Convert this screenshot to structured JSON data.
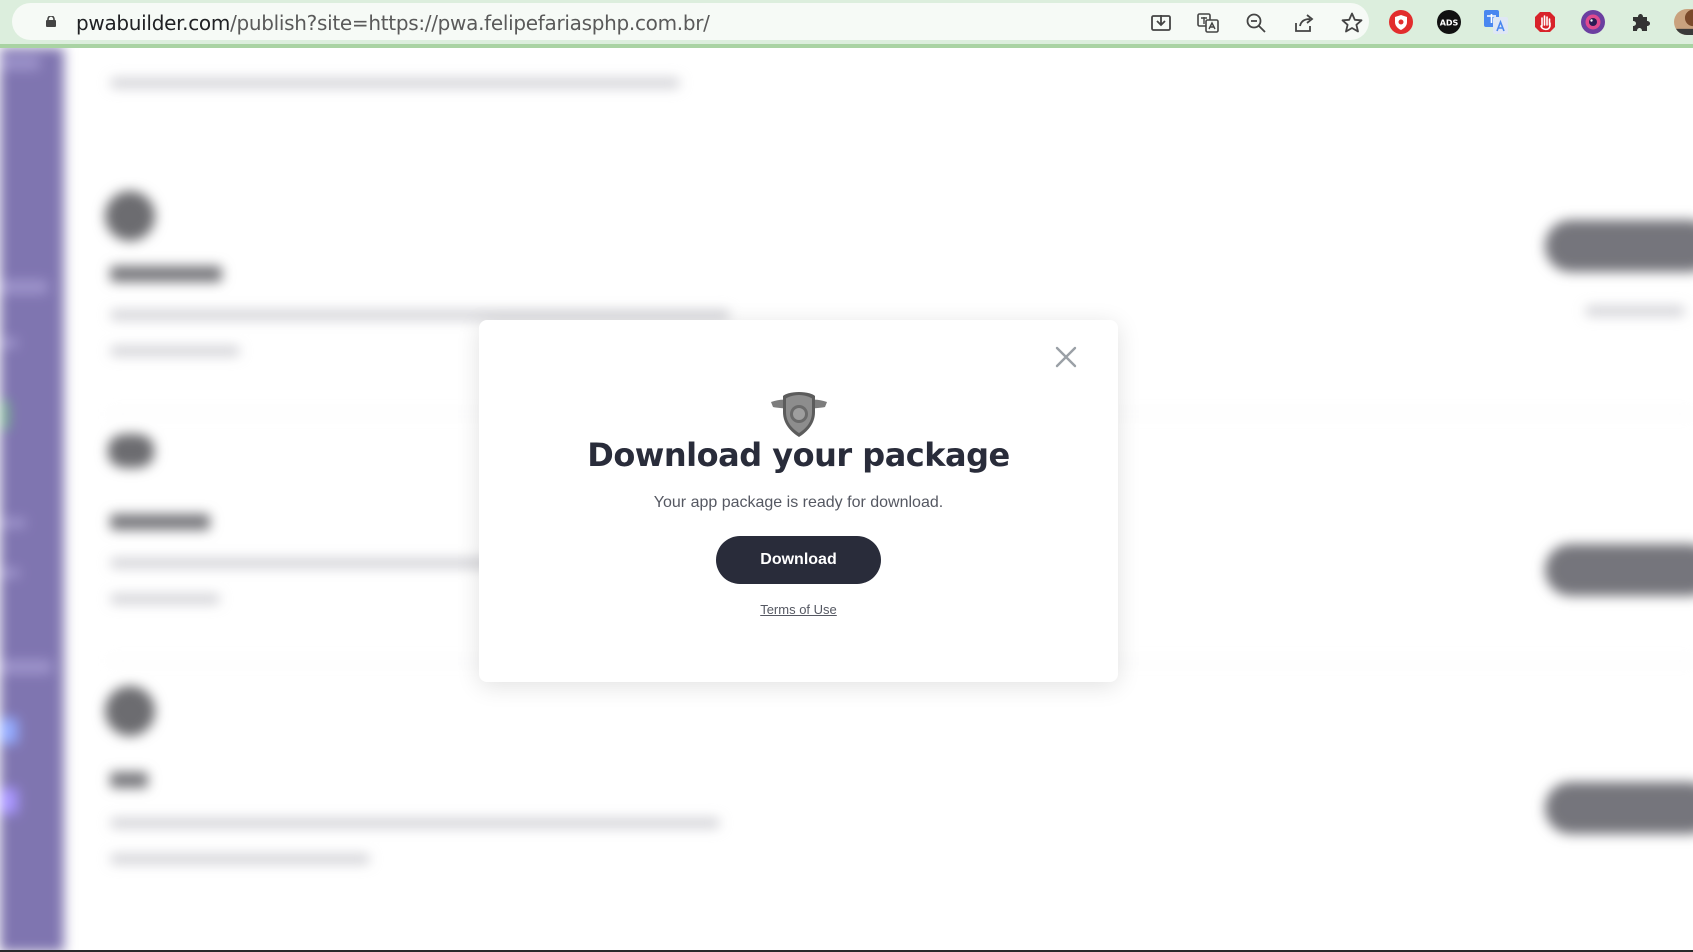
{
  "browser": {
    "url_host": "pwabuilder.com",
    "url_path": "/publish?site=https://pwa.felipefariasphp.com.br/",
    "toolbar_icons": [
      "install-app-icon",
      "translate-icon",
      "zoom-out-icon",
      "share-icon",
      "bookmark-star-icon"
    ],
    "extension_icons": [
      "shield-extension-icon",
      "ads-extension-icon",
      "google-translate-extension-icon",
      "hand-block-extension-icon",
      "camera-extension-icon",
      "puzzle-extensions-icon",
      "profile-avatar"
    ],
    "ads_badge_text": "ADS"
  },
  "modal": {
    "icon": "shield-wings-icon",
    "title": "Download your package",
    "text": "Your app package is ready for download.",
    "download_label": "Download",
    "terms_label": "Terms of Use",
    "close_icon": "close-icon"
  },
  "colors": {
    "primary_button": "#292c3a",
    "sidebar": "#3b2b86",
    "chrome": "#dceedd"
  }
}
